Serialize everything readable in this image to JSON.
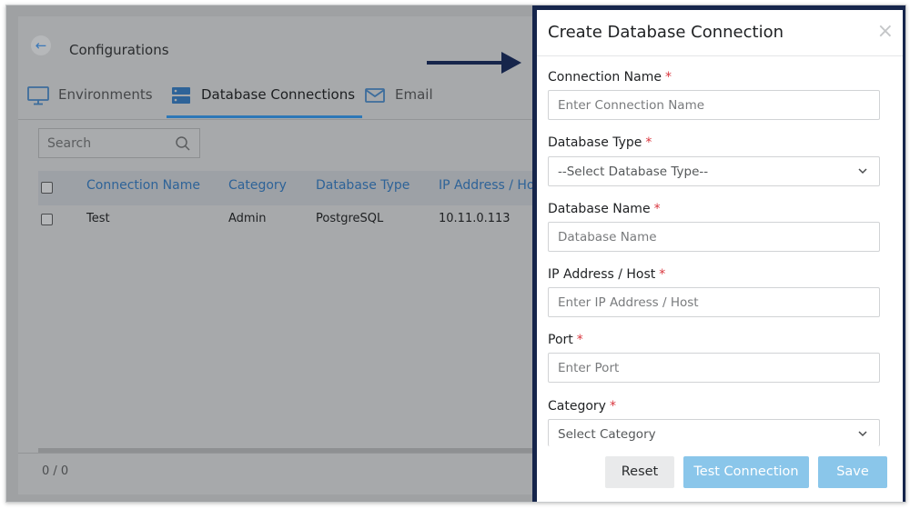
{
  "app": {
    "title": "Configurations",
    "back_icon": "arrow-left-icon",
    "tabs": [
      {
        "label": "Environments",
        "icon": "monitor-icon",
        "active": false
      },
      {
        "label": "Database Connections",
        "icon": "database-icon",
        "active": true
      },
      {
        "label": "Email",
        "icon": "envelope-icon",
        "active": false
      }
    ],
    "search": {
      "placeholder": "Search",
      "icon": "search-icon"
    },
    "table": {
      "columns": [
        "Connection Name",
        "Category",
        "Database Type",
        "IP Address / Host"
      ],
      "rows": [
        {
          "connection_name": "Test",
          "category": "Admin",
          "database_type": "PostgreSQL",
          "ip_address": "10.11.0.113"
        }
      ]
    },
    "pager": "0 / 0"
  },
  "modal": {
    "title": "Create Database Connection",
    "close_icon": "close-icon",
    "required_marker": "*",
    "fields": [
      {
        "label": "Connection Name",
        "placeholder": "Enter Connection Name",
        "type": "text"
      },
      {
        "label": "Database Type",
        "placeholder": "--Select Database Type--",
        "type": "select"
      },
      {
        "label": "Database Name",
        "placeholder": "Database Name",
        "type": "text"
      },
      {
        "label": "IP Address / Host",
        "placeholder": "Enter IP Address / Host",
        "type": "text"
      },
      {
        "label": "Port",
        "placeholder": "Enter Port",
        "type": "text"
      },
      {
        "label": "Category",
        "placeholder": "Select Category",
        "type": "select"
      }
    ],
    "buttons": {
      "reset": "Reset",
      "test": "Test Connection",
      "save": "Save"
    }
  },
  "colors": {
    "accent": "#2e78b7",
    "modal_border": "#16254b",
    "primary_button": "#8ac6ea",
    "required": "#d9363e"
  }
}
